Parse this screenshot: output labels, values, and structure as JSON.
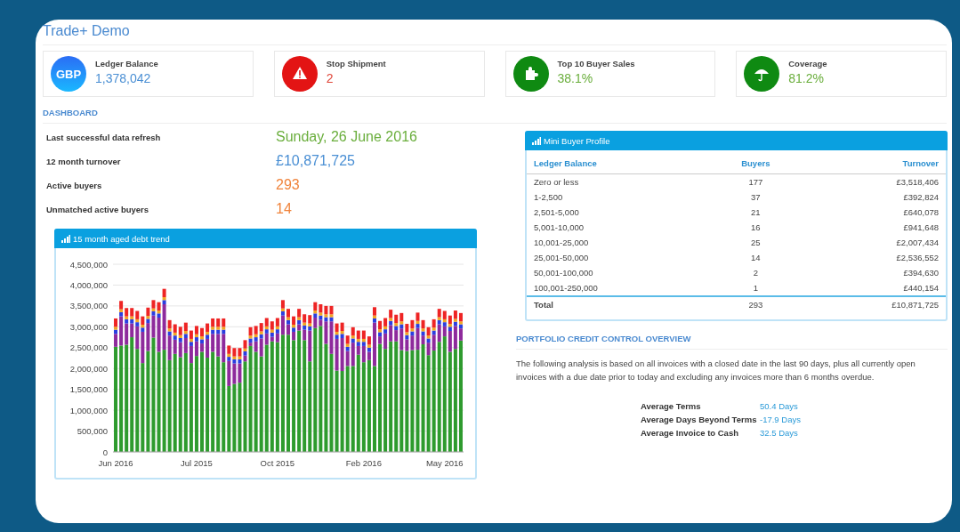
{
  "app": {
    "title": "Trade+ Demo"
  },
  "stat_cards": [
    {
      "kind": "currency",
      "icon_text": "GBP",
      "label": "Ledger Balance",
      "value": "1,378,042",
      "color": "#4a8fd4"
    },
    {
      "kind": "warning",
      "label": "Stop Shipment",
      "value": "2",
      "color": "#e0473a"
    },
    {
      "kind": "puzzle",
      "label": "Top 10 Buyer Sales",
      "value": "38.1%",
      "color": "#6aae3c"
    },
    {
      "kind": "umbrella",
      "label": "Coverage",
      "value": "81.2%",
      "color": "#6aae3c"
    }
  ],
  "dashboard": {
    "heading": "DASHBOARD",
    "rows": [
      {
        "label": "Last successful data refresh",
        "value": "Sunday, 26 June 2016",
        "color": "#6aae3c"
      },
      {
        "label": "12 month turnover",
        "value": "£10,871,725",
        "color": "#4a8fd4"
      },
      {
        "label": "Active buyers",
        "value": "293",
        "color": "#f0843c"
      },
      {
        "label": "Unmatched active buyers",
        "value": "14",
        "color": "#f0843c"
      }
    ]
  },
  "chart_panel": {
    "title": "15 month aged debt trend",
    "chart_data": {
      "type": "bar",
      "stacked": true,
      "grid": true,
      "categories": [
        "Jun 2016",
        null,
        null,
        null,
        null,
        null,
        null,
        null,
        null,
        null,
        null,
        null,
        null,
        null,
        null,
        "Jul 2015",
        null,
        null,
        null,
        null,
        null,
        null,
        null,
        null,
        null,
        null,
        null,
        null,
        null,
        null,
        "Oct 2015",
        null,
        null,
        null,
        null,
        null,
        null,
        null,
        null,
        null,
        null,
        null,
        null,
        null,
        null,
        null,
        "Feb 2016",
        null,
        null,
        null,
        null,
        null,
        null,
        null,
        null,
        null,
        null,
        null,
        null,
        null,
        null,
        "May 2016",
        null,
        null,
        null
      ],
      "ylim": [
        0,
        4500000
      ],
      "yticks": [
        {
          "value": 0,
          "label": "0"
        },
        {
          "value": 500000,
          "label": "500,000"
        },
        {
          "value": 1000000,
          "label": "1,000,000"
        },
        {
          "value": 1500000,
          "label": "1,500,000"
        },
        {
          "value": 2000000,
          "label": "2,000,000"
        },
        {
          "value": 2500000,
          "label": "2,500,000"
        },
        {
          "value": 3000000,
          "label": "3,000,000"
        },
        {
          "value": 3500000,
          "label": "3,500,000"
        },
        {
          "value": 4000000,
          "label": "4,000,000"
        },
        {
          "value": 4500000,
          "label": "4,500,000"
        }
      ],
      "series": [
        {
          "color": "#2e9b2e",
          "values": [
            2520000,
            2550000,
            2570000,
            2750000,
            2470000,
            2130000,
            2420000,
            2740000,
            2400000,
            2450000,
            2200000,
            2350000,
            2270000,
            2370000,
            2130000,
            2300000,
            2400000,
            2260000,
            2400000,
            2290000,
            2150000,
            1580000,
            1630000,
            1660000,
            2170000,
            2540000,
            2400000,
            2290000,
            2570000,
            2650000,
            2630000,
            2810000,
            2810000,
            2680000,
            2910000,
            2680000,
            2170000,
            2970000,
            3020000,
            2590000,
            2350000,
            1950000,
            1940000,
            2060000,
            2060000,
            2330000,
            2150000,
            2200000,
            2060000,
            2590000,
            2470000,
            2650000,
            2650000,
            2440000,
            2420000,
            2440000,
            2450000,
            2580000,
            2320000,
            2430000,
            2640000,
            2770000,
            2400000,
            2470000,
            2670000
          ]
        },
        {
          "color": "#8e2a9c",
          "values": [
            310000,
            700000,
            510000,
            330000,
            540000,
            750000,
            670000,
            530000,
            820000,
            1090000,
            590000,
            340000,
            360000,
            360000,
            410000,
            350000,
            200000,
            450000,
            430000,
            540000,
            680000,
            600000,
            490000,
            460000,
            140000,
            80000,
            250000,
            430000,
            270000,
            110000,
            210000,
            460000,
            250000,
            200000,
            150000,
            250000,
            740000,
            250000,
            150000,
            540000,
            780000,
            760000,
            790000,
            360000,
            560000,
            210000,
            390000,
            200000,
            1040000,
            180000,
            370000,
            390000,
            270000,
            520000,
            280000,
            350000,
            520000,
            210000,
            300000,
            380000,
            420000,
            240000,
            500000,
            550000,
            290000
          ]
        },
        {
          "color": "#2b3ee0",
          "values": [
            100000,
            100000,
            100000,
            100000,
            100000,
            100000,
            100000,
            100000,
            100000,
            100000,
            100000,
            100000,
            100000,
            100000,
            100000,
            100000,
            100000,
            100000,
            100000,
            100000,
            100000,
            100000,
            100000,
            100000,
            100000,
            100000,
            100000,
            100000,
            100000,
            100000,
            100000,
            100000,
            100000,
            100000,
            100000,
            100000,
            100000,
            100000,
            100000,
            100000,
            100000,
            100000,
            100000,
            100000,
            100000,
            100000,
            100000,
            100000,
            100000,
            100000,
            100000,
            100000,
            100000,
            100000,
            100000,
            100000,
            100000,
            100000,
            100000,
            100000,
            100000,
            100000,
            100000,
            100000,
            100000
          ]
        },
        {
          "color": "#f2a623",
          "values": [
            70000,
            70000,
            70000,
            70000,
            70000,
            70000,
            70000,
            70000,
            70000,
            70000,
            70000,
            70000,
            70000,
            70000,
            70000,
            70000,
            70000,
            70000,
            70000,
            70000,
            70000,
            70000,
            70000,
            70000,
            70000,
            70000,
            70000,
            70000,
            70000,
            70000,
            70000,
            70000,
            70000,
            70000,
            70000,
            70000,
            70000,
            70000,
            70000,
            70000,
            70000,
            70000,
            70000,
            70000,
            70000,
            70000,
            70000,
            70000,
            70000,
            70000,
            70000,
            70000,
            70000,
            70000,
            70000,
            70000,
            70000,
            70000,
            70000,
            70000,
            70000,
            70000,
            70000,
            70000,
            70000
          ]
        },
        {
          "color": "#ee2424",
          "values": [
            200000,
            200000,
            200000,
            200000,
            200000,
            200000,
            200000,
            200000,
            200000,
            200000,
            200000,
            200000,
            200000,
            200000,
            200000,
            200000,
            200000,
            200000,
            200000,
            200000,
            200000,
            200000,
            200000,
            200000,
            200000,
            200000,
            200000,
            200000,
            200000,
            200000,
            200000,
            200000,
            200000,
            200000,
            200000,
            200000,
            200000,
            200000,
            200000,
            200000,
            200000,
            200000,
            200000,
            200000,
            200000,
            200000,
            200000,
            200000,
            200000,
            200000,
            200000,
            200000,
            200000,
            200000,
            200000,
            200000,
            200000,
            200000,
            200000,
            200000,
            200000,
            200000,
            200000,
            200000,
            200000
          ]
        }
      ]
    }
  },
  "buyer_profile": {
    "title": "Mini Buyer Profile",
    "columns": [
      "Ledger Balance",
      "Buyers",
      "Turnover"
    ],
    "rows": [
      [
        "Zero or less",
        "177",
        "£3,518,406"
      ],
      [
        "1-2,500",
        "37",
        "£392,824"
      ],
      [
        "2,501-5,000",
        "21",
        "£640,078"
      ],
      [
        "5,001-10,000",
        "16",
        "£941,648"
      ],
      [
        "10,001-25,000",
        "25",
        "£2,007,434"
      ],
      [
        "25,001-50,000",
        "14",
        "£2,536,552"
      ],
      [
        "50,001-100,000",
        "2",
        "£394,630"
      ],
      [
        "100,001-250,000",
        "1",
        "£440,154"
      ]
    ],
    "total": [
      "Total",
      "293",
      "£10,871,725"
    ]
  },
  "portfolio": {
    "heading": "PORTFOLIO CREDIT CONTROL OVERVIEW",
    "text": "The following analysis is based on all invoices with a closed date in the last 90 days, plus all currently open invoices with a due date prior to today and excluding any invoices more than 6 months overdue.",
    "metrics": [
      {
        "label": "Average Terms",
        "value": "50.4 Days"
      },
      {
        "label": "Average Days Beyond Terms",
        "value": "-17.9 Days"
      },
      {
        "label": "Average Invoice to Cash",
        "value": "32.5 Days"
      }
    ]
  }
}
